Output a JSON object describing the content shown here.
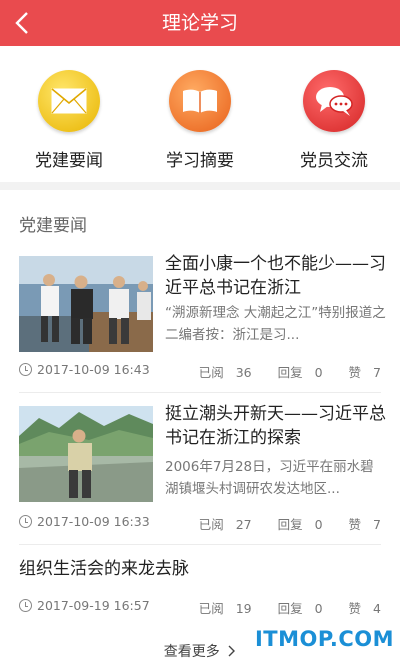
{
  "header": {
    "title": "理论学习"
  },
  "quick_nav": [
    {
      "label": "党建要闻",
      "icon": "envelope-icon",
      "color": "#f0c419"
    },
    {
      "label": "学习摘要",
      "icon": "book-icon",
      "color": "#f07f2d"
    },
    {
      "label": "党员交流",
      "icon": "chat-bubbles-icon",
      "color": "#e33e3e"
    }
  ],
  "section": {
    "title": "党建要闻"
  },
  "articles": [
    {
      "title": "全面小康一个也不能少——习近平总书记在浙江",
      "summary": "“溯源新理念 大潮起之江”特别报道之二编者按：浙江是习...",
      "time": "2017-10-09 16:43",
      "read_label": "已阅",
      "read": "36",
      "reply_label": "回复",
      "reply": "0",
      "like_label": "赞",
      "like": "7"
    },
    {
      "title": "挺立潮头开新天——习近平总书记在浙江的探索",
      "summary": "2006年7月28日，习近平在丽水碧湖镇堰头村调研农发达地区...",
      "time": "2017-10-09 16:33",
      "read_label": "已阅",
      "read": "27",
      "reply_label": "回复",
      "reply": "0",
      "like_label": "赞",
      "like": "7"
    },
    {
      "title": "组织生活会的来龙去脉",
      "time": "2017-09-19 16:57",
      "read_label": "已阅",
      "read": "19",
      "reply_label": "回复",
      "reply": "0",
      "like_label": "赞",
      "like": "4"
    }
  ],
  "more_label": "查看更多",
  "watermark": "ITMOP.COM",
  "colors": {
    "brand_red": "#e94b4e",
    "text": "#222222",
    "muted": "#777777"
  }
}
